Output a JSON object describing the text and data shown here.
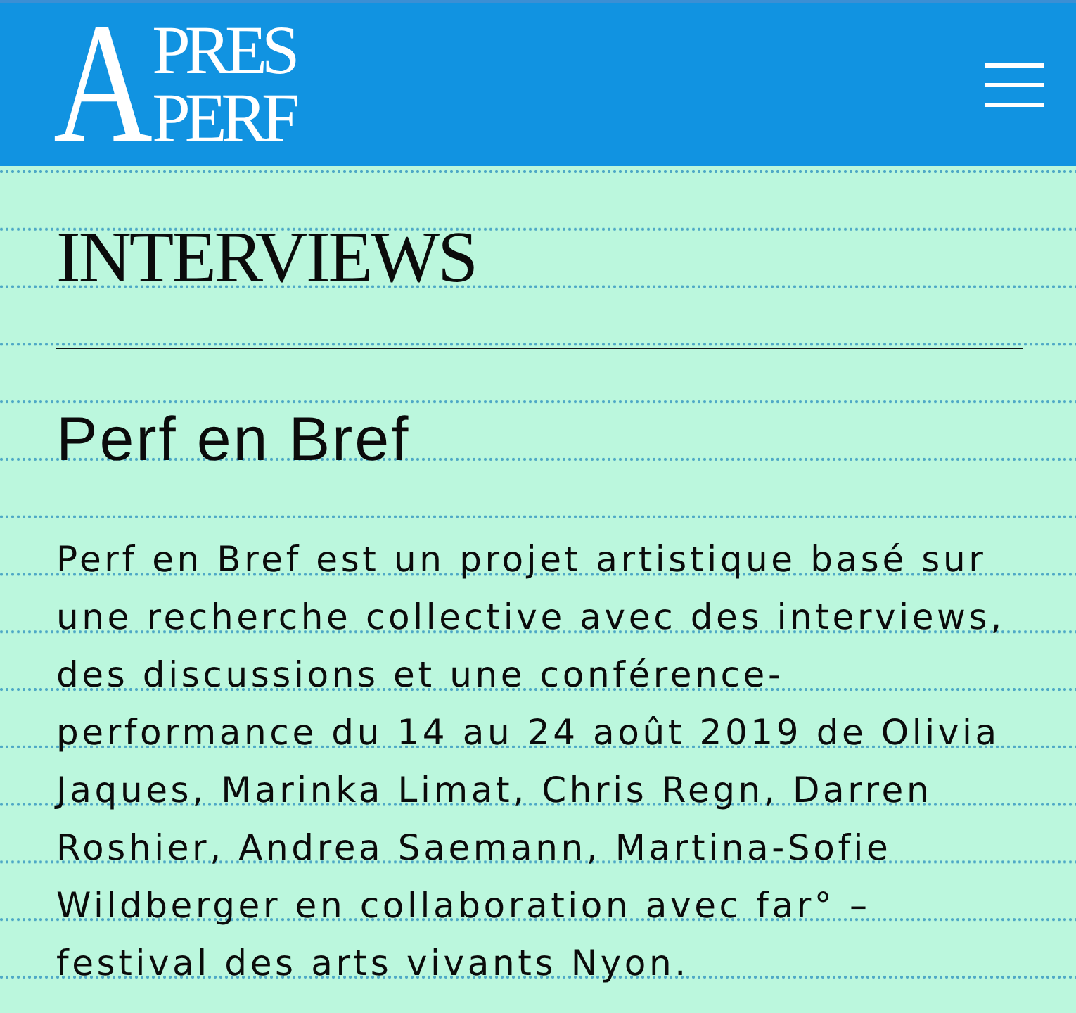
{
  "header": {
    "logo": {
      "initial": "A",
      "top_word": "PRES",
      "bottom_word": "PERF"
    }
  },
  "section": {
    "title": "INTERVIEWS"
  },
  "article": {
    "title": "Perf en Bref",
    "body": "Perf en Bref est un projet artistique basé sur une recherche collective avec des interviews, des discussions et une conférence-performance du 14 au 24 août 2019 de Olivia Jaques, Marinka Limat, Chris Regn, Darren Roshier, Andrea Saemann, Martina-Sofie Wildberger en collaboration avec far° – festival des arts vivants Nyon."
  }
}
